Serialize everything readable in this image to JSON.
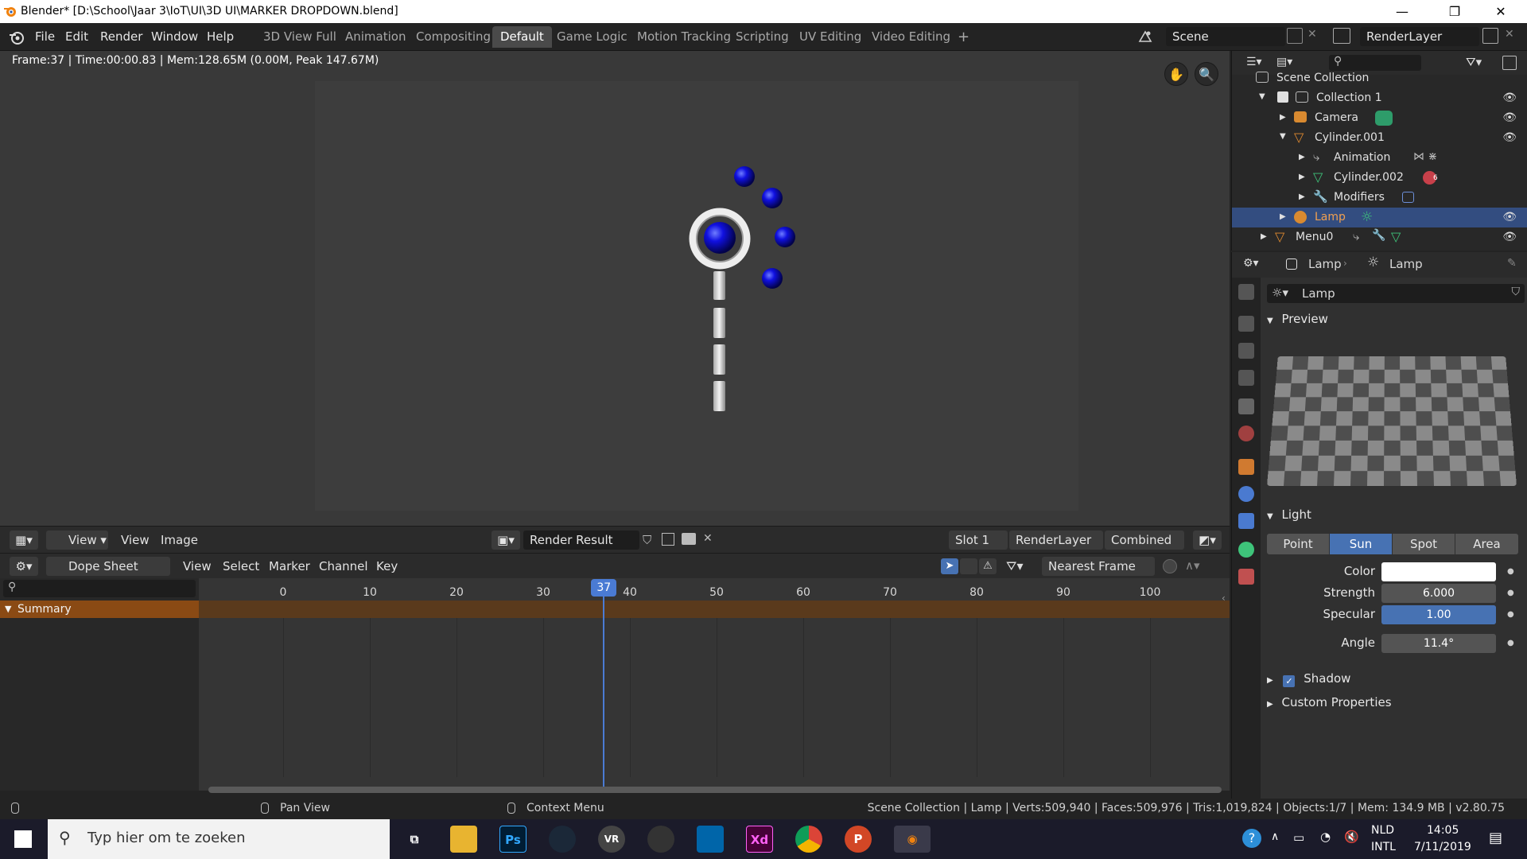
{
  "window": {
    "title": "Blender* [D:\\School\\Jaar 3\\IoT\\UI\\3D UI\\MARKER DROPDOWN.blend]",
    "minimize": "—",
    "maximize": "❐",
    "close": "✕"
  },
  "menu": {
    "items": [
      "File",
      "Edit",
      "Render",
      "Window",
      "Help"
    ]
  },
  "workspaces": {
    "tabs": [
      "3D View Full",
      "Animation",
      "Compositing",
      "Default",
      "Game Logic",
      "Motion Tracking",
      "Scripting",
      "UV Editing",
      "Video Editing"
    ],
    "active": "Default",
    "add": "+"
  },
  "scene": {
    "name": "Scene",
    "render_layer": "RenderLayer"
  },
  "viewport": {
    "stats": "Frame:37 | Time:00:00.83 | Mem:128.65M (0.00M, Peak 147.67M)"
  },
  "image_editor": {
    "view_menu": "View",
    "view": "View",
    "image": "Image",
    "image_name": "Render Result",
    "slot": "Slot 1",
    "layer": "RenderLayer",
    "pass": "Combined"
  },
  "dopesheet": {
    "mode": "Dope Sheet",
    "menus": [
      "View",
      "Select",
      "Marker",
      "Channel",
      "Key"
    ],
    "snap": "Nearest Frame",
    "search_placeholder": "",
    "summary": "Summary",
    "ticks": [
      "0",
      "10",
      "20",
      "30",
      "40",
      "50",
      "60",
      "70",
      "80",
      "90",
      "100"
    ],
    "current_frame": "37",
    "current_frame_value": 37
  },
  "statusbar": {
    "pan": "Pan View",
    "context": "Context Menu",
    "info": "Scene Collection | Lamp | Verts:509,940 | Faces:509,976 | Tris:1,019,824 | Objects:1/7 | Mem: 134.9 MB | v2.80.75"
  },
  "outliner": {
    "search_placeholder": "",
    "rows": [
      {
        "label": "Scene Collection"
      },
      {
        "label": "Collection 1"
      },
      {
        "label": "Camera"
      },
      {
        "label": "Cylinder.001"
      },
      {
        "label": "Animation"
      },
      {
        "label": "Cylinder.002",
        "badge": "6"
      },
      {
        "label": "Modifiers"
      },
      {
        "label": "Lamp"
      },
      {
        "label": "Menu0"
      }
    ]
  },
  "properties": {
    "breadcrumb_object": "Lamp",
    "breadcrumb_data": "Lamp",
    "datablock": "Lamp",
    "preview_panel": "Preview",
    "light_panel": "Light",
    "light_types": [
      "Point",
      "Sun",
      "Spot",
      "Area"
    ],
    "active_type": "Sun",
    "color_label": "Color",
    "strength_label": "Strength",
    "strength": "6.000",
    "specular_label": "Specular",
    "specular": "1.00",
    "specular_fraction": 1.0,
    "angle_label": "Angle",
    "angle": "11.4°",
    "shadow_panel": "Shadow",
    "custom_panel": "Custom Properties",
    "light_color": "#ffffff"
  },
  "taskbar": {
    "search_placeholder": "Typ hier om te zoeken",
    "apps": [
      "Ps",
      "VR",
      "Xd",
      "P"
    ],
    "language": "NLD",
    "layout": "INTL",
    "time": "14:05",
    "date": "7/11/2019"
  }
}
